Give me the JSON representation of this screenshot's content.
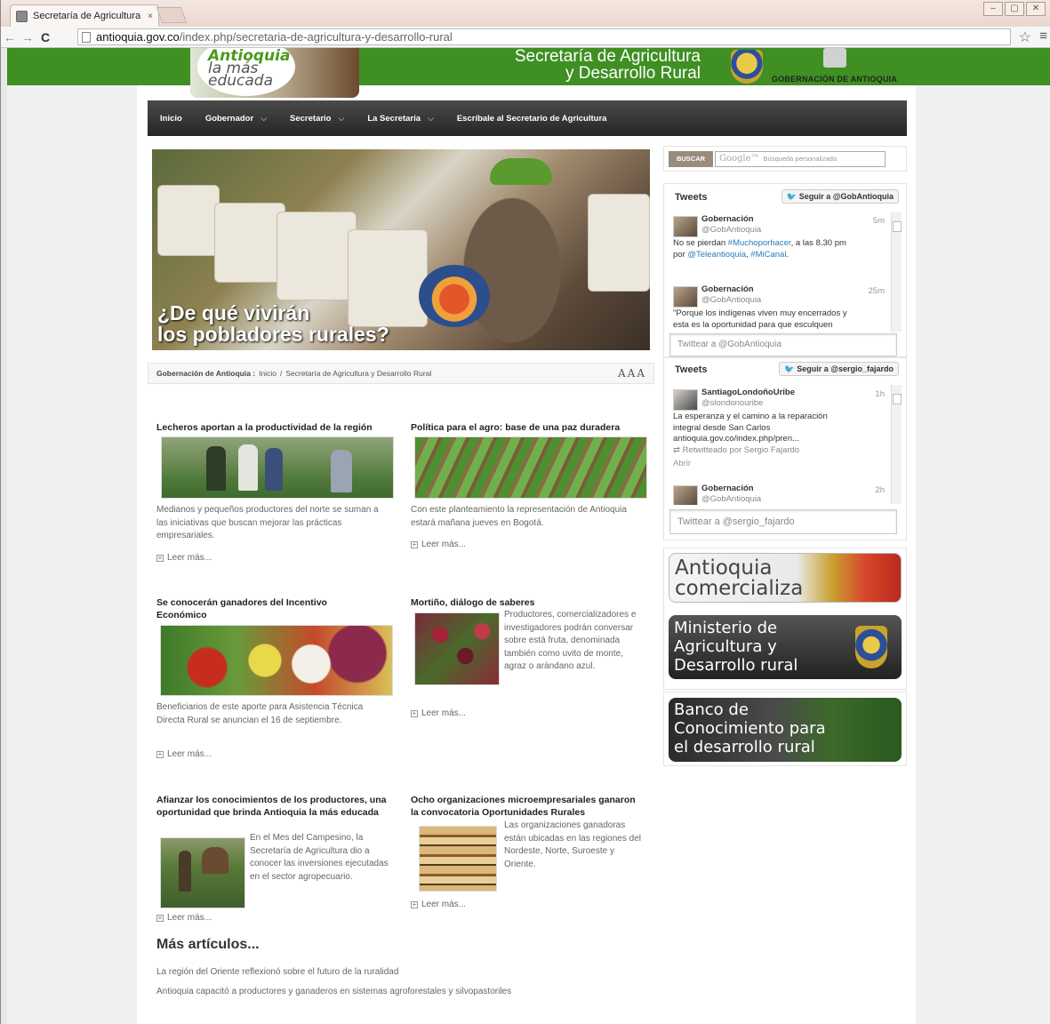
{
  "browser": {
    "tab_title": "Secretaría de Agricultura",
    "tab_close": "×",
    "url_host": "antioquia.gov.co",
    "url_path": "/index.php/secretaria-de-agricultura-y-desarrollo-rural",
    "back": "←",
    "forward": "→",
    "reload": "C",
    "star": "☆",
    "menu": "≡",
    "win_min": "–",
    "win_max": "▢",
    "win_close": "✕"
  },
  "header": {
    "logo_line1": "Antioquia",
    "logo_line2": "la más",
    "logo_line3": "educada",
    "title_line1": "Secretaría de Agricultura",
    "title_line2": "y Desarrollo Rural",
    "gobernacion": "GOBERNACIÓN DE ANTIOQUIA"
  },
  "nav": {
    "items": [
      {
        "label": "Inicio",
        "dropdown": false
      },
      {
        "label": "Gobernador",
        "dropdown": true
      },
      {
        "label": "Secretario",
        "dropdown": true
      },
      {
        "label": "La Secretaría",
        "dropdown": true
      },
      {
        "label": "Escríbale al Secretario de Agricultura",
        "dropdown": false
      }
    ],
    "chevron": "⌵"
  },
  "hero": {
    "caption_line1": "¿De qué vivirán",
    "caption_line2": "los pobladores rurales?"
  },
  "breadcrumb": {
    "root": "Gobernación de Antioquia :",
    "home": "Inicio",
    "sep": "/",
    "current": "Secretaría de Agricultura y Desarrollo Rural",
    "text_size": "AAA"
  },
  "articles": [
    {
      "title": "Lecheros aportan a la productividad de la región",
      "text": "Medianos y pequeños productores del norte se  suman a las iniciativas que buscan mejorar las prácticas empresariales.",
      "more": "Leer más..."
    },
    {
      "title": "Política para el agro: base de una paz duradera",
      "text": "Con este planteamiento la representación de Antioquia estará mañana jueves en Bogotá.",
      "more": "Leer más..."
    },
    {
      "title": "Se conocerán ganadores del Incentivo Económico",
      "text": "Beneficiarios de este aporte para Asistencia Técnica Directa Rural se anuncian el 16 de septiembre.",
      "more": "Leer más..."
    },
    {
      "title": "Mortiño, diálogo de saberes",
      "text": "Productores, comercializadores e investigadores podrán conversar sobre está fruta, denominada también como uvito de monte, agraz o arándano azul.",
      "more": "Leer más..."
    },
    {
      "title": "Afianzar los conocimientos de los productores, una oportunidad que brinda Antioquia la más educada",
      "text": "En el Mes del Campesino, la Secretaría de Agricultura dio a conocer las inversiones ejecutadas en el sector agropecuario.",
      "more": "Leer más..."
    },
    {
      "title": "Ocho organizaciones microempresariales ganaron la convocatoria Oportunidades Rurales",
      "text": "Las organizaciones ganadoras están ubicadas en las regiones del Nordeste, Norte, Suroeste y Oriente.",
      "more": "Leer más..."
    }
  ],
  "more_articles": {
    "title": "Más artículos...",
    "links": [
      "La región del Oriente reflexionó sobre el futuro de la ruralidad",
      "Antioquia capacitó a productores y ganaderos en sistemas agroforestales y silvopastoriles"
    ]
  },
  "search": {
    "button": "BUSCAR",
    "google": "Google™",
    "placeholder": "Búsqueda personalizada"
  },
  "twitter1": {
    "title": "Tweets",
    "follow": "Seguir a @GobAntioquia",
    "bird": "🐦",
    "tweets": [
      {
        "name": "Gobernación",
        "handle": "@GobAntioquia",
        "time": "5m",
        "t1": "No se pierdan ",
        "t1_link": "#Muchoporhacer",
        "t1b": ", a las 8.30 pm",
        "t2": "por ",
        "t2_link": "@Teleantioquia",
        "t2b": ", ",
        "t2_link2": "#MiCanal",
        "t2c": "."
      },
      {
        "name": "Gobernación",
        "handle": "@GobAntioquia",
        "time": "25m",
        "t1": "\"Porque los indígenas viven muy encerrados y",
        "t2": "esta es la oportunidad para que esculquen"
      }
    ],
    "compose": "Twittear a @GobAntioquia"
  },
  "twitter2": {
    "title": "Tweets",
    "follow": "Seguir a @sergio_fajardo",
    "bird": "🐦",
    "tweets": [
      {
        "name": "SantiagoLondoñoUribe",
        "handle": "@slondonouribe",
        "time": "1h",
        "t1": "La esperanza y el camino a la reparación",
        "t2": "integral desde San Carlos",
        "t3": " antioquia.gov.co/index.php/pren...",
        "rt": "⇄ Retwitteado por Sergio Fajardo",
        "open": "Abrir"
      },
      {
        "name": "Gobernación",
        "handle": "@GobAntioquia",
        "time": "2h"
      }
    ],
    "compose": "Twittear a @sergio_fajardo"
  },
  "banners": {
    "b1_line1": "Antioquia",
    "b1_line2": "comercializa",
    "b2_line1": "Ministerio de",
    "b2_line2": "Agricultura y",
    "b2_line3": "Desarrollo rural",
    "b3_line1": "Banco de",
    "b3_line2": "Conocimiento para",
    "b3_line3": "el desarrollo rural"
  }
}
